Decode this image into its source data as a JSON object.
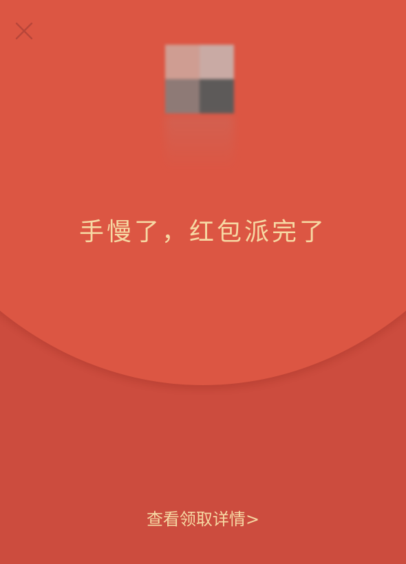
{
  "message": "手慢了，红包派完了",
  "details_link": "查看领取详情",
  "details_arrow": ">",
  "colors": {
    "envelope_bottom": "#cc4c3e",
    "envelope_top": "#dc5643",
    "text_gold": "#f6d9a4",
    "close_icon": "#b8463a"
  },
  "icons": {
    "close": "close-icon",
    "avatar": "pixelated-avatar",
    "arrow": "chevron-right"
  }
}
